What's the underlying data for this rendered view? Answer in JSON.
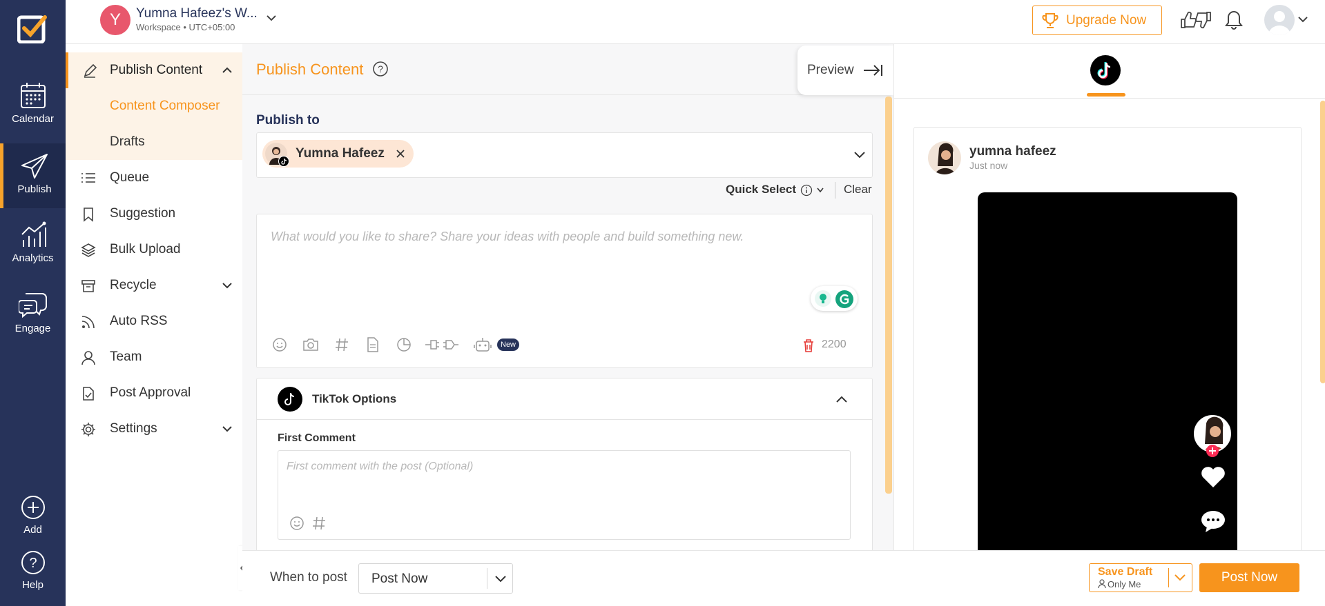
{
  "rail": {
    "items": [
      {
        "label": "Calendar",
        "icon": "calendar-icon"
      },
      {
        "label": "Publish",
        "icon": "paper-plane-icon"
      },
      {
        "label": "Analytics",
        "icon": "chart-icon"
      },
      {
        "label": "Engage",
        "icon": "chat-icon"
      }
    ],
    "add_label": "Add",
    "help_label": "Help"
  },
  "topbar": {
    "workspace_initial": "Y",
    "workspace_name": "Yumna Hafeez's W...",
    "workspace_sub": "Workspace • UTC+05:00",
    "upgrade_label": "Upgrade Now"
  },
  "sidebar": {
    "items": [
      {
        "label": "Publish Content",
        "icon": "edit-icon"
      },
      {
        "label": "Content Composer"
      },
      {
        "label": "Drafts"
      },
      {
        "label": "Queue",
        "icon": "list-icon"
      },
      {
        "label": "Suggestion",
        "icon": "bookmark-icon"
      },
      {
        "label": "Bulk Upload",
        "icon": "layers-icon"
      },
      {
        "label": "Recycle",
        "icon": "archive-icon"
      },
      {
        "label": "Auto RSS",
        "icon": "rss-icon"
      },
      {
        "label": "Team",
        "icon": "user-icon"
      },
      {
        "label": "Post Approval",
        "icon": "file-check-icon"
      },
      {
        "label": "Settings",
        "icon": "gear-icon"
      }
    ]
  },
  "composer": {
    "title": "Publish Content",
    "preview_label": "Preview",
    "publish_to_label": "Publish to",
    "account_chip": "Yumna Hafeez",
    "quick_select_label": "Quick Select",
    "clear_label": "Clear",
    "editor_placeholder": "What would you like to share? Share your ideas with people and build something new.",
    "new_badge": "New",
    "char_count": "2200",
    "tiktok_options_label": "TikTok Options",
    "first_comment_label": "First Comment",
    "first_comment_placeholder": "First comment with the post (Optional)"
  },
  "preview_panel": {
    "username": "yumna hafeez",
    "time": "Just now"
  },
  "bottom": {
    "when_label": "When to post",
    "when_value": "Post Now",
    "save_draft_label": "Save Draft",
    "save_draft_sub": "Only Me",
    "post_now_label": "Post Now"
  },
  "colors": {
    "accent": "#f7941d",
    "rail": "#27335a",
    "tiktok_black": "#000000"
  }
}
